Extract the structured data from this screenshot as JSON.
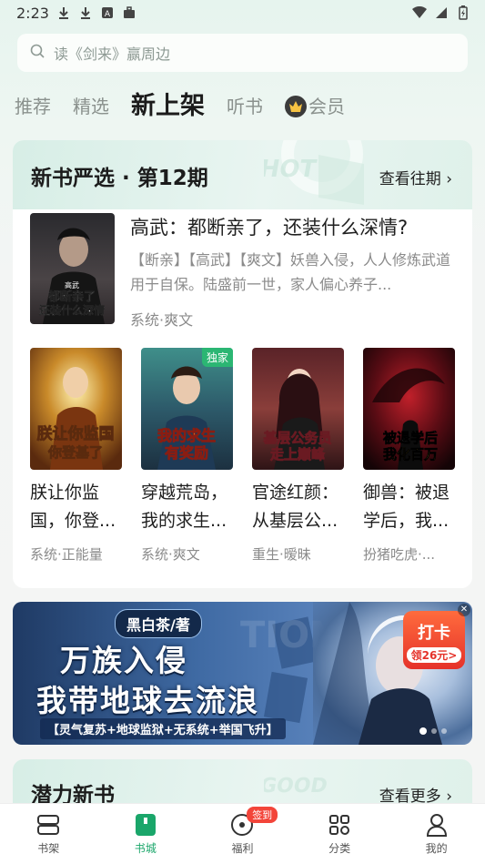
{
  "status_bar": {
    "time": "2:23"
  },
  "search": {
    "placeholder": "读《剑来》赢周边"
  },
  "top_tabs": [
    {
      "label": "推荐"
    },
    {
      "label": "精选"
    },
    {
      "label": "新上架"
    },
    {
      "label": "听书"
    },
    {
      "label": "会员"
    }
  ],
  "new_books_section": {
    "title": "新书严选 · 第12期",
    "more": "查看往期",
    "featured": {
      "title": "高武：都断亲了，还装什么深情?",
      "description": "【断亲】【高武】【爽文】妖兽入侵，人人修炼武道用于自保。陆盛前一世，家人偏心养子...",
      "tags": "系统·爽文"
    },
    "books": [
      {
        "title": "朕让你监国，你登...",
        "tags": "系统·正能量",
        "exclusive": ""
      },
      {
        "title": "穿越荒岛，我的求生...",
        "tags": "系统·爽文",
        "exclusive": "独家"
      },
      {
        "title": "官途红颜：从基层公...",
        "tags": "重生·暧昧",
        "exclusive": ""
      },
      {
        "title": "御兽：被退学后，我...",
        "tags": "扮猪吃虎·...",
        "exclusive": ""
      }
    ]
  },
  "banner": {
    "brand": "黑白茶/著",
    "line1": "万族入侵",
    "line2": "我带地球去流浪",
    "subtitle": "【灵气复苏+地球监狱+无系统+举国飞升】",
    "checkin_title": "打卡",
    "checkin_sub": "领26元>",
    "slides": 3,
    "active_slide": 1
  },
  "potential_section": {
    "title": "潜力新书",
    "more": "查看更多"
  },
  "bottom_nav": [
    {
      "label": "书架"
    },
    {
      "label": "书城"
    },
    {
      "label": "福利",
      "badge": "签到"
    },
    {
      "label": "分类"
    },
    {
      "label": "我的"
    }
  ],
  "colors": {
    "accent": "#1aa66a",
    "badge": "#f3453a"
  }
}
